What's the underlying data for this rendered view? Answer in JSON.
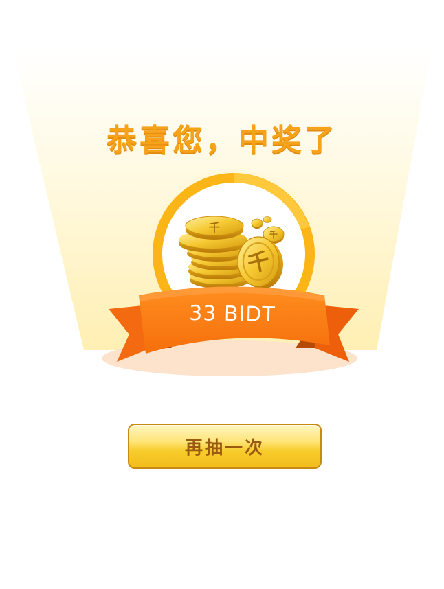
{
  "result": {
    "title": "恭喜您，中奖了",
    "amount": "33 BIDT",
    "coin_glyph": "千"
  },
  "actions": {
    "retry_label": "再抽一次"
  },
  "colors": {
    "title": "#f7a21b",
    "ribbon": "#f7730f",
    "ring": "#fbb516",
    "button": "#f7cc2c",
    "button_text": "#9a5a12",
    "background_glow": "#fff4cc"
  }
}
